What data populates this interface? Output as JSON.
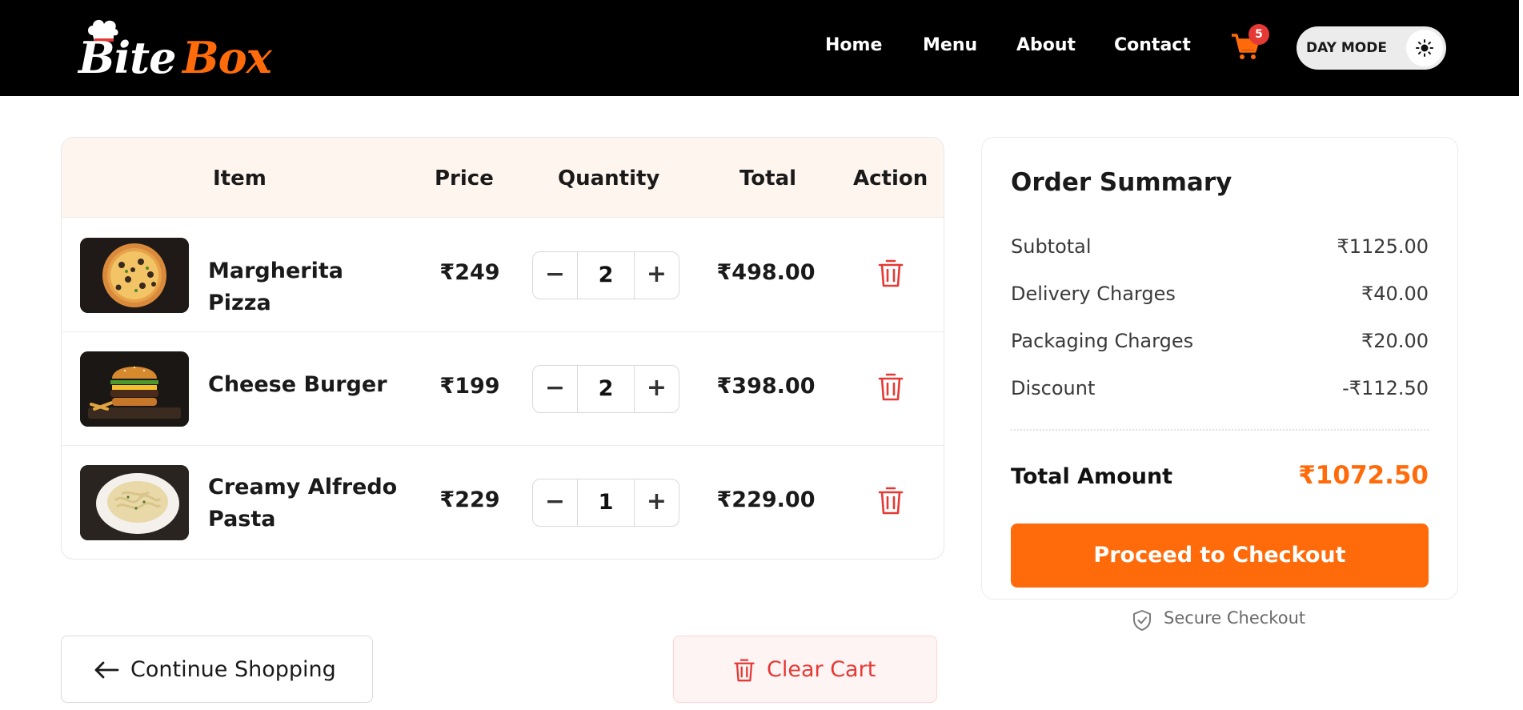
{
  "header": {
    "logo": {
      "part1": "Bite",
      "part2": "Box"
    },
    "nav": [
      "Home",
      "Menu",
      "About",
      "Contact"
    ],
    "cart_count": "5",
    "theme_toggle_label": "DAY MODE"
  },
  "cart": {
    "columns": [
      "Item",
      "Price",
      "Quantity",
      "Total",
      "Action"
    ],
    "items": [
      {
        "name": "Margherita Pizza",
        "price": "₹249",
        "quantity": "2",
        "total": "₹498.00"
      },
      {
        "name": "Cheese Burger",
        "price": "₹199",
        "quantity": "2",
        "total": "₹398.00"
      },
      {
        "name": "Creamy Alfredo Pasta",
        "price": "₹229",
        "quantity": "1",
        "total": "₹229.00"
      }
    ],
    "minus_label": "−",
    "plus_label": "+"
  },
  "summary": {
    "title": "Order Summary",
    "rows": [
      {
        "label": "Subtotal",
        "value": "₹1125.00"
      },
      {
        "label": "Delivery Charges",
        "value": "₹40.00"
      },
      {
        "label": "Packaging Charges",
        "value": "₹20.00"
      },
      {
        "label": "Discount",
        "value": "-₹112.50"
      }
    ],
    "total_label": "Total Amount",
    "total_value": "₹1072.50",
    "checkout_label": "Proceed to Checkout",
    "secure_label": "Secure Checkout"
  },
  "actions": {
    "continue_label": "Continue Shopping",
    "clear_label": "Clear Cart"
  },
  "colors": {
    "accent": "#ff6b0a",
    "danger": "#e53935",
    "header_bg": "#000000",
    "table_head_bg": "#fff5ef"
  }
}
